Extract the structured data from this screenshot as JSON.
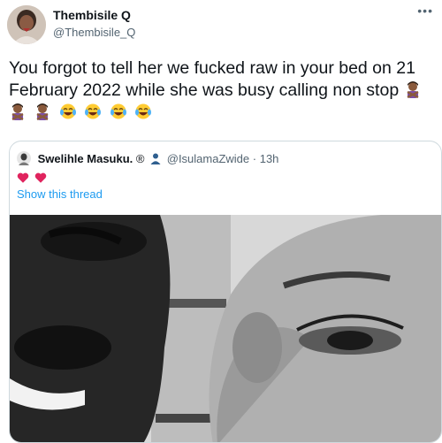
{
  "tweet": {
    "author_name": "Thembisile Q",
    "author_handle": "@Thembisile_Q",
    "more_icon": "ellipsis-icon",
    "text": "You forgot to tell her we fucked raw in your bed  on 21 February 2022 while she was busy calling non stop",
    "emojis": [
      "person-gesturing-no",
      "person-gesturing-no",
      "person-gesturing-no",
      "tears-of-joy",
      "tears-of-joy",
      "tears-of-joy",
      "tears-of-joy"
    ]
  },
  "quoted": {
    "name": "Swelihle Masuku.",
    "symbols": "®",
    "handle": "@IsulamaZwide",
    "time": "· 13h",
    "hearts": [
      "red-heart",
      "red-heart"
    ],
    "show_thread": "Show this thread",
    "photo": "black-and-white selfie photo"
  },
  "colors": {
    "text": "#0f1419",
    "secondary": "#536471",
    "link": "#1d9bf0",
    "border": "#cfd9de",
    "heart": "#e0245e"
  }
}
